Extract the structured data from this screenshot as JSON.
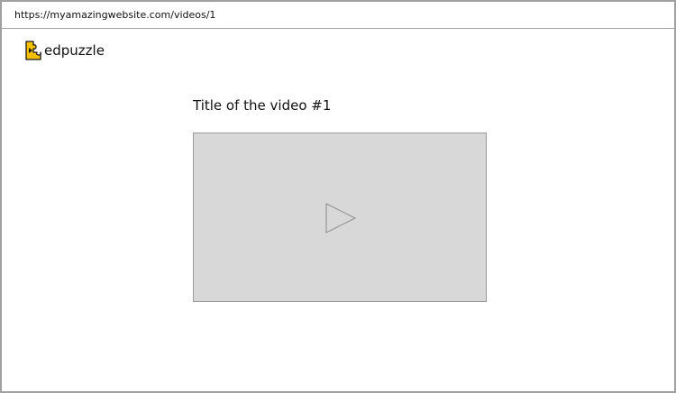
{
  "browser": {
    "url": "https://myamazingwebsite.com/videos/1"
  },
  "header": {
    "logo_text": "edpuzzle",
    "logo_color": "#f5c000"
  },
  "main": {
    "video_title": "Title of the video #1",
    "player_background": "#d8d8d8",
    "play_icon": "play-icon"
  }
}
